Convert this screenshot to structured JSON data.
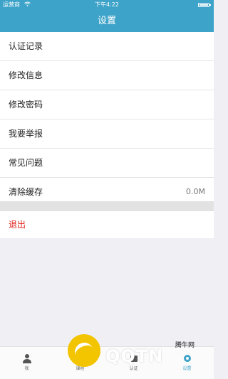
{
  "status_bar": {
    "carrier": "运营商",
    "time": "下午4:22"
  },
  "nav": {
    "title": "设置"
  },
  "menu": {
    "items": [
      {
        "label": "认证记录",
        "value": ""
      },
      {
        "label": "修改信息",
        "value": ""
      },
      {
        "label": "修改密码",
        "value": ""
      },
      {
        "label": "我要举报",
        "value": ""
      },
      {
        "label": "常见问题",
        "value": ""
      },
      {
        "label": "清除缓存",
        "value": "0.0M"
      }
    ]
  },
  "logout": {
    "label": "退出"
  },
  "tab_bar": {
    "tabs": [
      {
        "label": "我",
        "icon": "person-icon"
      },
      {
        "label": "课程",
        "icon": "book-icon"
      },
      {
        "label": "认证",
        "icon": "badge-icon"
      },
      {
        "label": "设置",
        "icon": "gear-icon"
      }
    ],
    "active_tab": "设置"
  },
  "watermark": {
    "text": "QQTN",
    "site": "腾牛网"
  },
  "colors": {
    "accent": "#3da3c9",
    "danger": "#e2231a"
  }
}
